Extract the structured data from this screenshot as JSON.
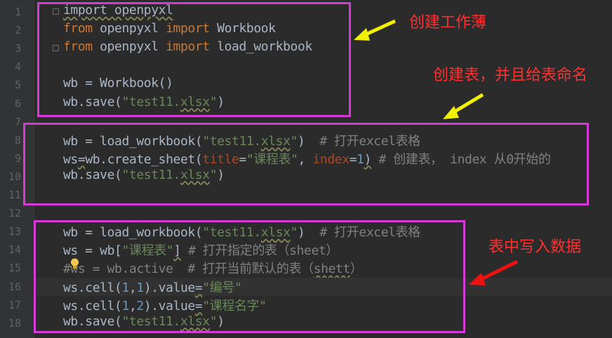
{
  "editor": {
    "line_numbers": [
      "1",
      "2",
      "3",
      "4",
      "5",
      "6",
      "7",
      "8",
      "9",
      "10",
      "11",
      "12",
      "13",
      "14",
      "15",
      "16",
      "17",
      "18"
    ],
    "lines": [
      [
        {
          "t": "import openpyxl",
          "c": "wavy"
        }
      ],
      [
        {
          "t": "from",
          "c": "kw"
        },
        {
          "t": " openpyxl "
        },
        {
          "t": "import",
          "c": "kw"
        },
        {
          "t": " Workbook"
        }
      ],
      [
        {
          "t": "from",
          "c": "kw"
        },
        {
          "t": " openpyxl "
        },
        {
          "t": "import",
          "c": "kw"
        },
        {
          "t": " load_workbook"
        }
      ],
      [],
      [
        {
          "t": "wb = Workbook()"
        }
      ],
      [
        {
          "t": "wb.save("
        },
        {
          "t": "\"test11.",
          "c": "str"
        },
        {
          "t": "xlsx",
          "c": "str wavy"
        },
        {
          "t": "\"",
          "c": "str"
        },
        {
          "t": ")"
        }
      ],
      [],
      [
        {
          "t": "wb = load_workbook("
        },
        {
          "t": "\"test11.",
          "c": "str"
        },
        {
          "t": "xlsx",
          "c": "str wavy"
        },
        {
          "t": "\"",
          "c": "str"
        },
        {
          "t": ")  "
        },
        {
          "t": "# 打开excel表格",
          "c": "cm"
        }
      ],
      [
        {
          "t": "ws"
        },
        {
          "t": "=",
          "c": "wavy"
        },
        {
          "t": "wb.create_sheet("
        },
        {
          "t": "title",
          "c": "param"
        },
        {
          "t": "="
        },
        {
          "t": "\"课程表\"",
          "c": "str"
        },
        {
          "t": ", "
        },
        {
          "t": "index",
          "c": "param"
        },
        {
          "t": "="
        },
        {
          "t": "1",
          "c": "num"
        },
        {
          "t": ")",
          "c": "wavy"
        },
        {
          "t": " "
        },
        {
          "t": "# 创建表， index 从0开始的",
          "c": "cm"
        }
      ],
      [
        {
          "t": "wb.save("
        },
        {
          "t": "\"test11.",
          "c": "str"
        },
        {
          "t": "xlsx",
          "c": "str wavy"
        },
        {
          "t": "\"",
          "c": "str"
        },
        {
          "t": ")"
        }
      ],
      [],
      [],
      [
        {
          "t": "wb = load_workbook("
        },
        {
          "t": "\"test11.",
          "c": "str"
        },
        {
          "t": "xlsx",
          "c": "str wavy"
        },
        {
          "t": "\"",
          "c": "str"
        },
        {
          "t": ")  "
        },
        {
          "t": "# 打开excel表格",
          "c": "cm"
        }
      ],
      [
        {
          "t": "ws = wb["
        },
        {
          "t": "\"课程表\"",
          "c": "str"
        },
        {
          "t": "]",
          "c": "wavy"
        },
        {
          "t": " "
        },
        {
          "t": "# 打开指定的表（sheet）",
          "c": "cm"
        }
      ],
      [
        {
          "t": "#ws = wb.active  # 打开当前默认的表（",
          "c": "cm"
        },
        {
          "t": "shett",
          "c": "cm wavy"
        },
        {
          "t": "）",
          "c": "cm"
        }
      ],
      [
        {
          "t": "ws.cell("
        },
        {
          "t": "1",
          "c": "num"
        },
        {
          "t": ","
        },
        {
          "t": "1",
          "c": "num"
        },
        {
          "t": ").value"
        },
        {
          "t": "=",
          "c": "wavy"
        },
        {
          "t": "\"编号\"",
          "c": "str"
        }
      ],
      [
        {
          "t": "ws.cell("
        },
        {
          "t": "1",
          "c": "num"
        },
        {
          "t": ","
        },
        {
          "t": "2",
          "c": "num"
        },
        {
          "t": ").value"
        },
        {
          "t": "=",
          "c": "wavy"
        },
        {
          "t": "\"课程名字\"",
          "c": "str"
        }
      ],
      [
        {
          "t": "wb.save("
        },
        {
          "t": "\"test11.",
          "c": "str"
        },
        {
          "t": "xlsx",
          "c": "str wavy"
        },
        {
          "t": "\"",
          "c": "str"
        },
        {
          "t": ")"
        }
      ]
    ]
  },
  "annotations": {
    "create_workbook": "创建工作薄",
    "create_sheet": "创建表，并且给表命名",
    "write_data": "表中写入数据"
  },
  "colors": {
    "background": "#2b2b2b",
    "gutter": "#313335",
    "highlight_box": "#d63ad6",
    "annotation_text": "#ff3030",
    "arrow_yellow": "#f0f000",
    "arrow_red": "#ee1111",
    "keyword": "#cc7832",
    "string": "#6a8759",
    "comment": "#808080",
    "number": "#6897bb"
  },
  "icons": [
    "lightbulb-icon",
    "fold-marker-icon",
    "arrow-icon"
  ]
}
